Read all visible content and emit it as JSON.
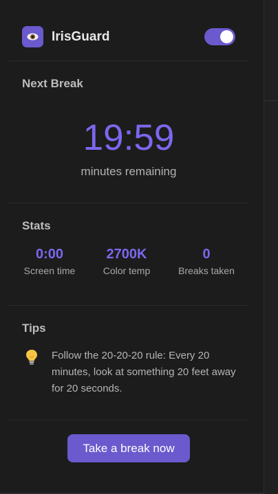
{
  "header": {
    "app_name": "IrisGuard",
    "logo_icon": "eye-icon",
    "toggle_on": true
  },
  "next_break": {
    "title": "Next Break",
    "timer": "19:59",
    "caption": "minutes remaining"
  },
  "stats": {
    "title": "Stats",
    "items": [
      {
        "value": "0:00",
        "label": "Screen time"
      },
      {
        "value": "2700K",
        "label": "Color temp"
      },
      {
        "value": "0",
        "label": "Breaks taken"
      }
    ]
  },
  "tips": {
    "title": "Tips",
    "icon": "lightbulb-icon",
    "text": "Follow the 20-20-20 rule: Every 20 minutes, look at something 20 feet away for 20 seconds."
  },
  "actions": {
    "break_button": "Take a break now"
  },
  "colors": {
    "accent": "#6a5acd",
    "accent_text": "#7b68ee",
    "background": "#1c1c1c"
  }
}
